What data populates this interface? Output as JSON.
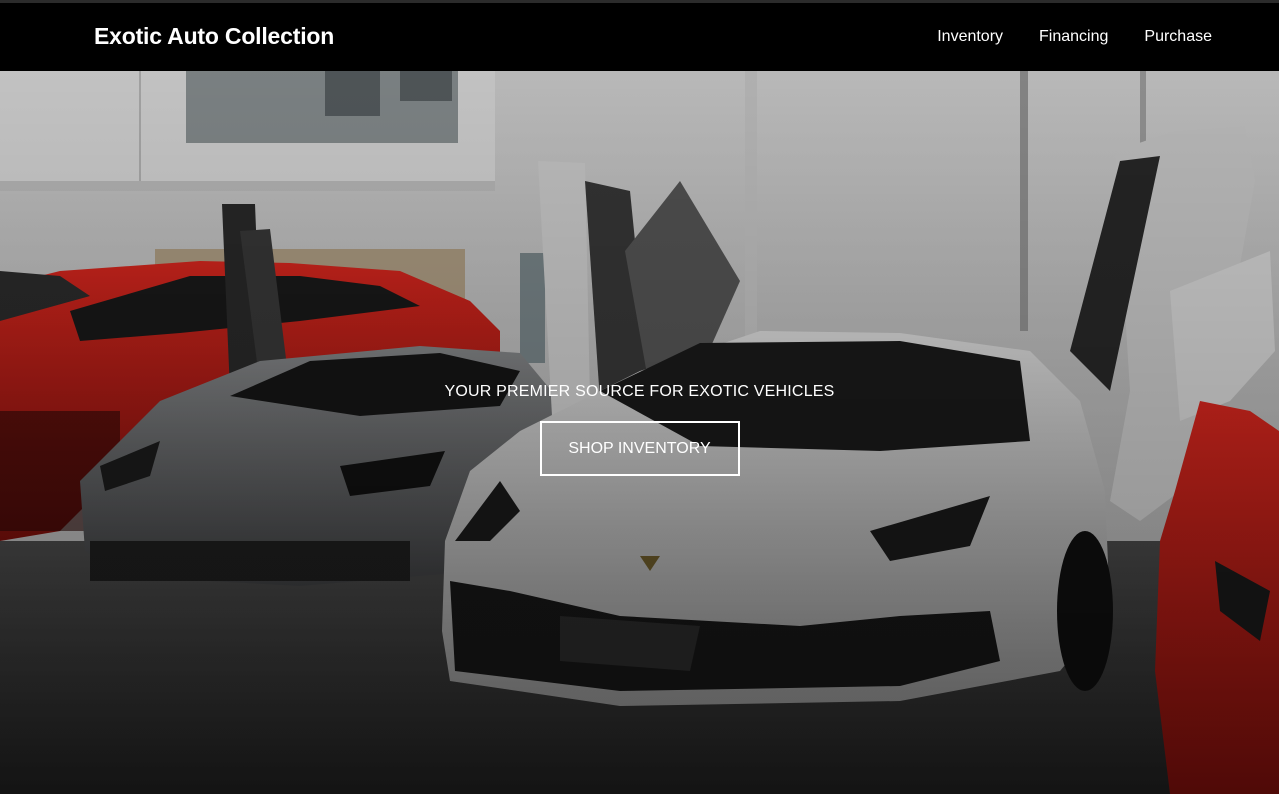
{
  "header": {
    "brand": "Exotic Auto Collection",
    "nav": [
      {
        "label": "Inventory"
      },
      {
        "label": "Financing"
      },
      {
        "label": "Purchase"
      }
    ]
  },
  "hero": {
    "tagline": "YOUR PREMIER SOURCE FOR EXOTIC VEHICLES",
    "cta_label": "SHOP INVENTORY",
    "image_description_icon": "showroom-photo",
    "colors": {
      "header_bg": "#000000",
      "text": "#ffffff",
      "red_car": "#c8201b",
      "grey_car": "#5f6163",
      "white_car": "#c9c9c9"
    }
  }
}
